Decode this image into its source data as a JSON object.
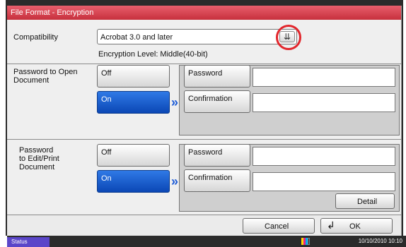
{
  "title": "File Format - Encryption",
  "compatibility": {
    "label": "Compatibility",
    "value": "Acrobat 3.0 and later",
    "dropdown_icon": "chevron-down-double-icon"
  },
  "encryption_level": "Encryption Level: Middle(40-bit)",
  "open_doc": {
    "label_line1": "Password to Open",
    "label_line2": "Document",
    "off": "Off",
    "on": "On",
    "password_label": "Password",
    "confirmation_label": "Confirmation"
  },
  "edit_doc": {
    "label_line1": "Password",
    "label_line2": "to Edit/Print",
    "label_line3": "Document",
    "off": "Off",
    "on": "On",
    "password_label": "Password",
    "confirmation_label": "Confirmation",
    "detail": "Detail"
  },
  "footer": {
    "cancel": "Cancel",
    "ok": "OK",
    "ok_icon": "return-arrow-icon"
  },
  "statusbar": {
    "status": "Status",
    "datetime": "10/10/2010 10:10"
  },
  "colors": {
    "title": "#c7303d",
    "selected": "#1152c7",
    "highlight_ring": "#e2262c",
    "status": "#5a46c9"
  }
}
